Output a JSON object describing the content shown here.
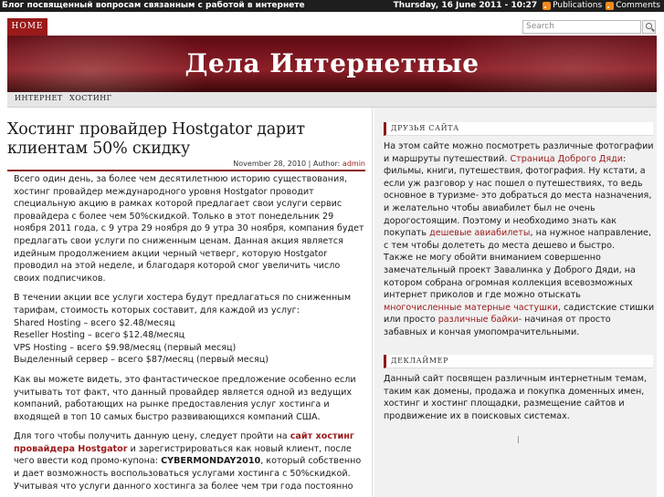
{
  "topbar": {
    "tagline": "Блог посвященный вопросам связанным с работой в интернете",
    "date": "Thursday, 16 June 2011 - 10:27",
    "feeds": [
      "Publications",
      "Comments"
    ],
    "feed_icon": "rss-icon",
    "accent": "#f08a1c"
  },
  "nav": {
    "home_label": "HOME",
    "search_placeholder": "Search",
    "search_icon": "search-icon"
  },
  "header": {
    "site_title": "Дела Интернетные",
    "colors": {
      "banner": "#7a1620",
      "accent": "#9a1a1a"
    }
  },
  "categories": [
    "ИНТЕРНЕТ",
    "ХОСТИНГ"
  ],
  "post": {
    "title": "Хостинг провайдер Hostgator дарит клиентам 50% скидку",
    "date": "November 28, 2010",
    "author_label": "Author:",
    "author": "admin",
    "p1": "Всего один день, за более чем десятилетнюю историю существования, хостинг провайдер международного уровня Hostgator проводит специальную акцию в рамках которой предлагает свои услуги сервис провайдера с более чем 50%скидкой. Только в этот понедельник 29 ноября 2011 года, с 9 утра 29 ноября до 9 утра 30 ноября, компания будет предлагать свои услуги по сниженным ценам. Данная акция является идейным продолжением акции черный четверг, которую Hostgator проводил на этой неделе, и благодаря которой смог увеличить число своих подписчиков.",
    "p2_intro": "В течении акции все услуги хостера будут предлагаться по сниженным тарифам, стоимость которых составит, для каждой из услуг:",
    "prices": [
      "Shared Hosting – всего $2.48/месяц",
      "Reseller Hosting – всего $12.48/месяц",
      "VPS Hosting – всего $9.98/месяц (первый месяц)",
      "Выделенный сервер – всего $87/месяц (первый месяц)"
    ],
    "p3": "Как вы можете видеть, это фантастическое предложение особенно если учитывать тот факт, что данный провайдер является одной из ведущих компаний, работающих на рынке предоставления услуг хостинга и входящей в топ 10 самых быстро развивающихся компаний США.",
    "p4_a": "Для того чтобы получить данную цену, следует пройти на",
    "p4_link": "сайт хостинг провайдера Hostgator",
    "p4_b": "и зарегистрироваться как новый клиент, после чего ввести код промо-купона:",
    "p4_code": "CYBERMONDAY2010",
    "p4_c": ", который собственно и дает возможность воспользоваться услугами хостинга с 50%скидкой. Учитывая что услуги данного хостинга за более чем три года постоянно"
  },
  "sidebar": {
    "friends": {
      "title": "ДРУЗЬЯ САЙТА",
      "t1": "На этом сайте можно посмотреть различные фотографии и маршруты путешествий.",
      "l1": "Страница Доброго Дяди",
      "t2": ": фильмы, книги, путешествия, фотография. Ну кстати, а если уж разговор у нас пошел о путешествиях, то ведь основное в туризме- это добраться до места назначения, и желательно чтобы авиабилет был не очень дорогостоящим. Поэтому и необходимо знать как покупать",
      "l2": "дешевые авиабилеты",
      "t3": ", на нужное направление, с тем чтобы долететь до места дешево и быстро.",
      "t4": "Также не могу обойти вниманием совершенно замечательный проект Завалинка у Доброго Дяди, на котором собрана огромная коллекция всевозможных интернет приколов и где можно отыскать",
      "l3": "многочисленные матерные частушки",
      "t5": ", садистские стишки или просто",
      "l4": "различные байки",
      "t6": "- начиная от просто забавных и кончая умопомрачительными."
    },
    "disclaimer": {
      "title": "ДЕКЛАЙМЕР",
      "text": "Данный сайт посвящен различным интернетным темам, таким как домены, продажа и покупка доменных имен, хостинг и хостинг площадки, размещение сайтов и продвижение их в поисковых системах."
    }
  }
}
